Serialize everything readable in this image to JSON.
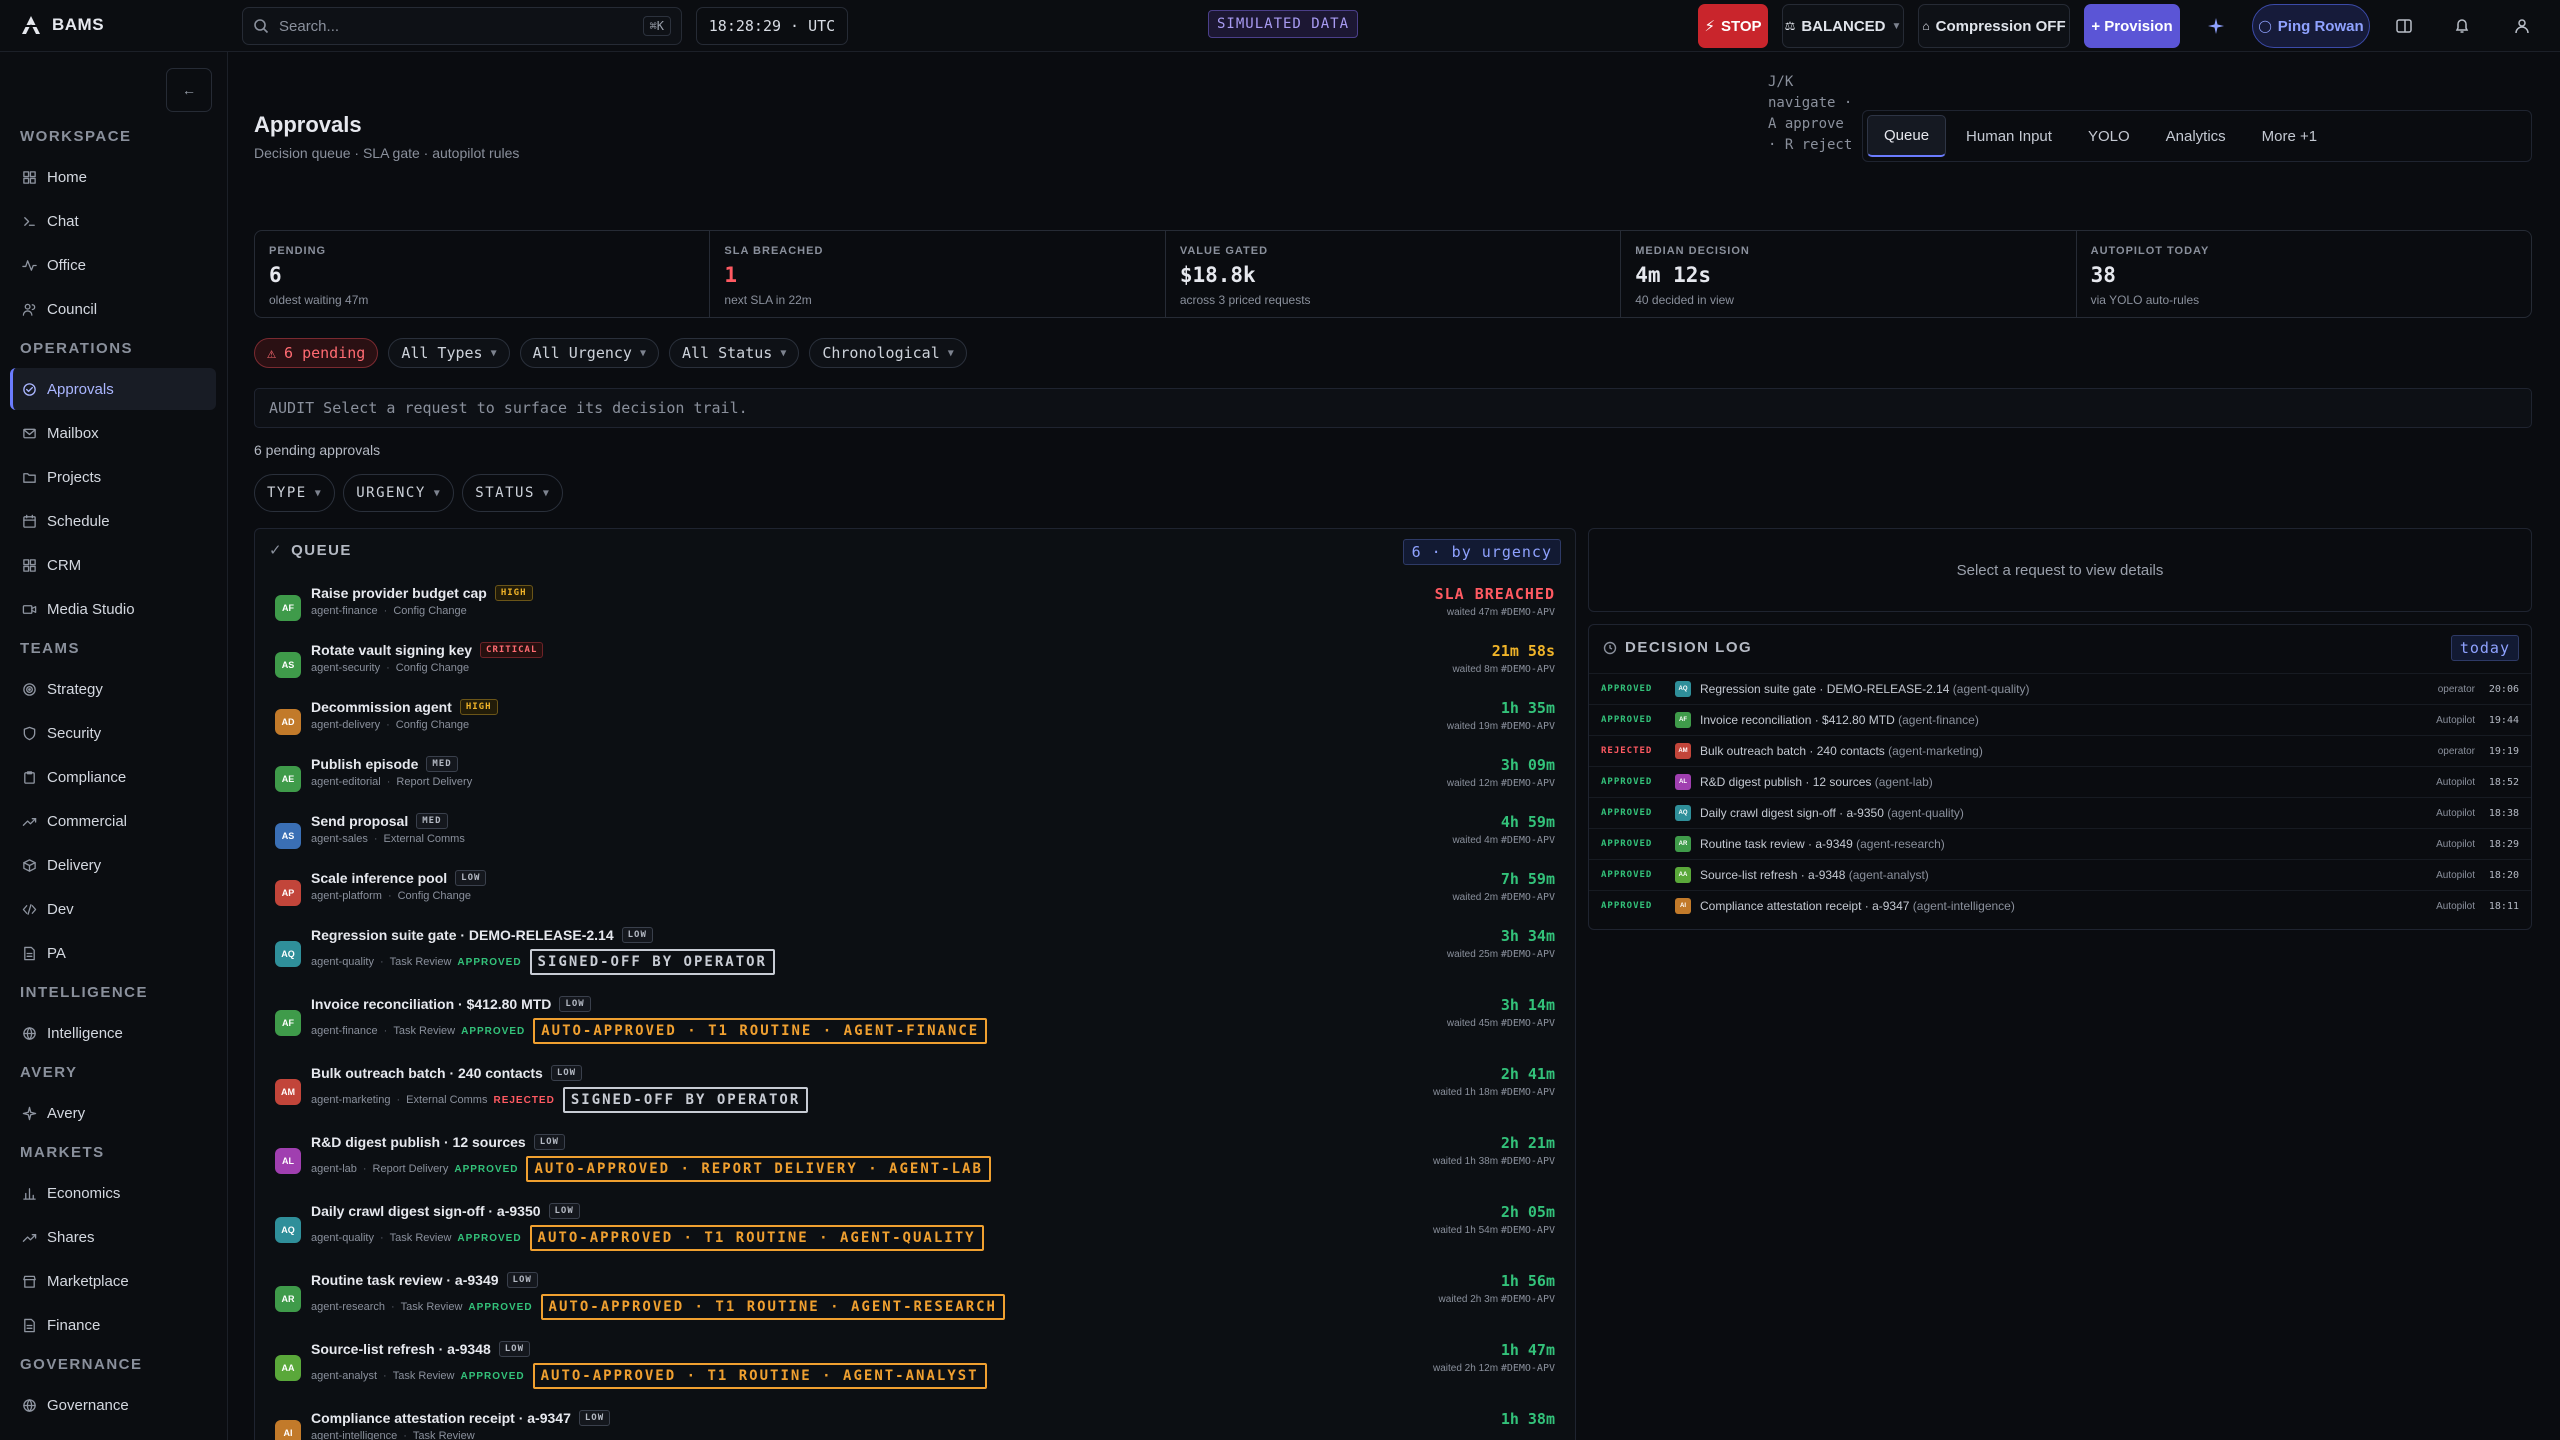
{
  "brand": {
    "name": "BAMS"
  },
  "topbar": {
    "search_placeholder": "Search...",
    "search_shortcut": "⌘K",
    "clock": "18:28:29 · UTC",
    "sim_badge": "SIMULATED DATA",
    "stop_label": "STOP",
    "mode_label": "BALANCED",
    "compression_label": "Compression OFF",
    "provision_label": "+ Provision",
    "ping_label": "Ping Rowan"
  },
  "sidebar": {
    "sections": [
      {
        "title": "WORKSPACE",
        "items": [
          {
            "label": "Home",
            "icon": "grid-icon"
          },
          {
            "label": "Chat",
            "icon": "terminal-icon"
          },
          {
            "label": "Office",
            "icon": "activity-icon"
          },
          {
            "label": "Council",
            "icon": "users-icon"
          }
        ]
      },
      {
        "title": "OPERATIONS",
        "items": [
          {
            "label": "Approvals",
            "icon": "check-circle-icon",
            "active": true
          },
          {
            "label": "Mailbox",
            "icon": "mail-icon"
          },
          {
            "label": "Projects",
            "icon": "folder-icon"
          },
          {
            "label": "Schedule",
            "icon": "calendar-icon"
          },
          {
            "label": "CRM",
            "icon": "grid-icon"
          },
          {
            "label": "Media Studio",
            "icon": "video-icon"
          }
        ]
      },
      {
        "title": "TEAMS",
        "items": [
          {
            "label": "Strategy",
            "icon": "target-icon"
          },
          {
            "label": "Security",
            "icon": "shield-icon"
          },
          {
            "label": "Compliance",
            "icon": "clipboard-icon"
          },
          {
            "label": "Commercial",
            "icon": "trending-icon"
          },
          {
            "label": "Delivery",
            "icon": "package-icon"
          },
          {
            "label": "Dev",
            "icon": "code-icon"
          },
          {
            "label": "PA",
            "icon": "file-icon"
          }
        ]
      },
      {
        "title": "INTELLIGENCE",
        "items": [
          {
            "label": "Intelligence",
            "icon": "globe-icon"
          }
        ]
      },
      {
        "title": "AVERY",
        "items": [
          {
            "label": "Avery",
            "icon": "sparkle-icon"
          }
        ]
      },
      {
        "title": "MARKETS",
        "items": [
          {
            "label": "Economics",
            "icon": "bar-chart-icon"
          },
          {
            "label": "Shares",
            "icon": "trending-icon"
          },
          {
            "label": "Marketplace",
            "icon": "store-icon"
          },
          {
            "label": "Finance",
            "icon": "file-icon"
          }
        ]
      },
      {
        "title": "GOVERNANCE",
        "items": [
          {
            "label": "Governance",
            "icon": "globe-icon"
          }
        ]
      }
    ]
  },
  "page": {
    "title": "Approvals",
    "subtitle": "Decision queue · SLA gate · autopilot rules",
    "hint": "J/K navigate · A approve · R reject",
    "tabs": [
      "Queue",
      "Human Input",
      "YOLO",
      "Analytics",
      "More +1"
    ]
  },
  "stats": [
    {
      "label": "PENDING",
      "value": "6",
      "sub": "oldest waiting 47m",
      "color": "#e6e8ee"
    },
    {
      "label": "SLA BREACHED",
      "value": "1",
      "sub": "next SLA in 22m",
      "color": "#ff5a62"
    },
    {
      "label": "VALUE GATED",
      "value": "$18.8k",
      "sub": "across 3 priced requests",
      "color": "#e6e8ee"
    },
    {
      "label": "MEDIAN DECISION",
      "value": "4m 12s",
      "sub": "40 decided in view",
      "color": "#e6e8ee"
    },
    {
      "label": "AUTOPILOT TODAY",
      "value": "38",
      "sub": "via YOLO auto-rules",
      "color": "#e6e8ee"
    }
  ],
  "filters": {
    "pending": "6 pending",
    "types": "All Types",
    "urgency": "All Urgency",
    "status": "All Status",
    "order": "Chronological"
  },
  "audit_text": "AUDIT Select a request to surface its decision trail.",
  "pending_count": "6 pending approvals",
  "column_filters": [
    "TYPE",
    "URGENCY",
    "STATUS"
  ],
  "queue": {
    "title": "QUEUE",
    "badge": "6 · by urgency",
    "rows": [
      {
        "initials": "AF",
        "color": "#3f9b4a",
        "title": "Raise provider budget cap",
        "urgency": "HIGH",
        "agent": "agent-finance",
        "type": "Config Change",
        "status": "",
        "stamp": "",
        "time": "SLA BREACHED",
        "time_class": "red",
        "waited": "waited 47m",
        "ref": "#DEMO-APV"
      },
      {
        "initials": "AS",
        "color": "#3f9b4a",
        "title": "Rotate vault signing key",
        "urgency": "CRITICAL",
        "agent": "agent-security",
        "type": "Config Change",
        "status": "",
        "stamp": "",
        "time": "21m 58s",
        "time_class": "amber",
        "waited": "waited 8m",
        "ref": "#DEMO-APV"
      },
      {
        "initials": "AD",
        "color": "#c27a2a",
        "title": "Decommission agent",
        "urgency": "HIGH",
        "agent": "agent-delivery",
        "type": "Config Change",
        "status": "",
        "stamp": "",
        "time": "1h 35m",
        "time_class": "green",
        "waited": "waited 19m",
        "ref": "#DEMO-APV"
      },
      {
        "initials": "AE",
        "color": "#3f9b4a",
        "title": "Publish episode",
        "urgency": "MED",
        "agent": "agent-editorial",
        "type": "Report Delivery",
        "status": "",
        "stamp": "",
        "time": "3h 09m",
        "time_class": "green",
        "waited": "waited 12m",
        "ref": "#DEMO-APV"
      },
      {
        "initials": "AS",
        "color": "#3a6fb5",
        "title": "Send proposal",
        "urgency": "MED",
        "agent": "agent-sales",
        "type": "External Comms",
        "status": "",
        "stamp": "",
        "time": "4h 59m",
        "time_class": "green",
        "waited": "waited 4m",
        "ref": "#DEMO-APV"
      },
      {
        "initials": "AP",
        "color": "#c2453a",
        "title": "Scale inference pool",
        "urgency": "LOW",
        "agent": "agent-platform",
        "type": "Config Change",
        "status": "",
        "stamp": "",
        "time": "7h 59m",
        "time_class": "green",
        "waited": "waited 2m",
        "ref": "#DEMO-APV"
      },
      {
        "initials": "AQ",
        "color": "#2f8f9a",
        "title": "Regression suite gate · DEMO-RELEASE-2.14",
        "urgency": "LOW",
        "agent": "agent-quality",
        "type": "Task Review",
        "status": "APPROVED",
        "stamp": "SIGNED-OFF BY OPERATOR",
        "stamp_class": "signed",
        "time": "3h 34m",
        "time_class": "green",
        "waited": "waited 25m",
        "ref": "#DEMO-APV"
      },
      {
        "initials": "AF",
        "color": "#3f9b4a",
        "title": "Invoice reconciliation · $412.80 MTD",
        "urgency": "LOW",
        "agent": "agent-finance",
        "type": "Task Review",
        "status": "APPROVED",
        "stamp": "AUTO-APPROVED · T1 ROUTINE · AGENT-FINANCE",
        "stamp_class": "auto",
        "time": "3h 14m",
        "time_class": "green",
        "waited": "waited 45m",
        "ref": "#DEMO-APV"
      },
      {
        "initials": "AM",
        "color": "#c2453a",
        "title": "Bulk outreach batch · 240 contacts",
        "urgency": "LOW",
        "agent": "agent-marketing",
        "type": "External Comms",
        "status": "REJECTED",
        "stamp": "SIGNED-OFF BY OPERATOR",
        "stamp_class": "signed",
        "time": "2h 41m",
        "time_class": "green",
        "waited": "waited 1h 18m",
        "ref": "#DEMO-APV"
      },
      {
        "initials": "AL",
        "color": "#a03fb0",
        "title": "R&D digest publish · 12 sources",
        "urgency": "LOW",
        "agent": "agent-lab",
        "type": "Report Delivery",
        "status": "APPROVED",
        "stamp": "AUTO-APPROVED · REPORT DELIVERY · AGENT-LAB",
        "stamp_class": "auto",
        "time": "2h 21m",
        "time_class": "green",
        "waited": "waited 1h 38m",
        "ref": "#DEMO-APV"
      },
      {
        "initials": "AQ",
        "color": "#2f8f9a",
        "title": "Daily crawl digest sign-off · a-9350",
        "urgency": "LOW",
        "agent": "agent-quality",
        "type": "Task Review",
        "status": "APPROVED",
        "stamp": "AUTO-APPROVED · T1 ROUTINE · AGENT-QUALITY",
        "stamp_class": "auto",
        "time": "2h 05m",
        "time_class": "green",
        "waited": "waited 1h 54m",
        "ref": "#DEMO-APV"
      },
      {
        "initials": "AR",
        "color": "#3f9b4a",
        "title": "Routine task review · a-9349",
        "urgency": "LOW",
        "agent": "agent-research",
        "type": "Task Review",
        "status": "APPROVED",
        "stamp": "AUTO-APPROVED · T1 ROUTINE · AGENT-RESEARCH",
        "stamp_class": "auto",
        "time": "1h 56m",
        "time_class": "green",
        "waited": "waited 2h 3m",
        "ref": "#DEMO-APV"
      },
      {
        "initials": "AA",
        "color": "#5aa83a",
        "title": "Source-list refresh · a-9348",
        "urgency": "LOW",
        "agent": "agent-analyst",
        "type": "Task Review",
        "status": "APPROVED",
        "stamp": "AUTO-APPROVED · T1 ROUTINE · AGENT-ANALYST",
        "stamp_class": "auto",
        "time": "1h 47m",
        "time_class": "green",
        "waited": "waited 2h 12m",
        "ref": "#DEMO-APV"
      },
      {
        "initials": "AI",
        "color": "#c27a2a",
        "title": "Compliance attestation receipt · a-9347",
        "urgency": "LOW",
        "agent": "agent-intelligence",
        "type": "Task Review",
        "status": "",
        "stamp": "",
        "time": "1h 38m",
        "time_class": "green",
        "waited": "",
        "ref": ""
      }
    ]
  },
  "detail_empty": "Select a request to view details",
  "decision_log": {
    "title": "DECISION LOG",
    "badge": "today",
    "rows": [
      {
        "status": "APPROVED",
        "initials": "AQ",
        "color": "#2f8f9a",
        "text": "Regression suite gate · DEMO-RELEASE-2.14",
        "agent": "(agent-quality)",
        "by": "operator",
        "time": "20:06"
      },
      {
        "status": "APPROVED",
        "initials": "AF",
        "color": "#3f9b4a",
        "text": "Invoice reconciliation · $412.80 MTD",
        "agent": "(agent-finance)",
        "by": "Autopilot",
        "time": "19:44"
      },
      {
        "status": "REJECTED",
        "initials": "AM",
        "color": "#c2453a",
        "text": "Bulk outreach batch · 240 contacts",
        "agent": "(agent-marketing)",
        "by": "operator",
        "time": "19:19"
      },
      {
        "status": "APPROVED",
        "initials": "AL",
        "color": "#a03fb0",
        "text": "R&D digest publish · 12 sources",
        "agent": "(agent-lab)",
        "by": "Autopilot",
        "time": "18:52"
      },
      {
        "status": "APPROVED",
        "initials": "AQ",
        "color": "#2f8f9a",
        "text": "Daily crawl digest sign-off · a-9350",
        "agent": "(agent-quality)",
        "by": "Autopilot",
        "time": "18:38"
      },
      {
        "status": "APPROVED",
        "initials": "AR",
        "color": "#3f9b4a",
        "text": "Routine task review · a-9349",
        "agent": "(agent-research)",
        "by": "Autopilot",
        "time": "18:29"
      },
      {
        "status": "APPROVED",
        "initials": "AA",
        "color": "#5aa83a",
        "text": "Source-list refresh · a-9348",
        "agent": "(agent-analyst)",
        "by": "Autopilot",
        "time": "18:20"
      },
      {
        "status": "APPROVED",
        "initials": "AI",
        "color": "#c27a2a",
        "text": "Compliance attestation receipt · a-9347",
        "agent": "(agent-intelligence)",
        "by": "Autopilot",
        "time": "18:11"
      }
    ]
  }
}
